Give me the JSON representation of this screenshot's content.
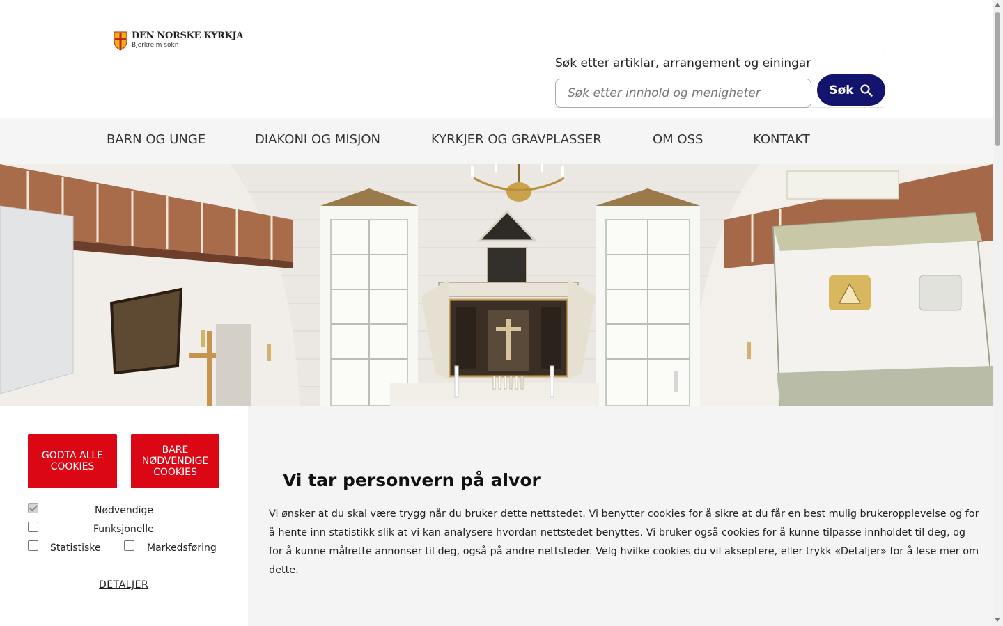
{
  "logo": {
    "title": "DEN NORSKE KYRKJA",
    "subtitle": "Bjerkreim sokn"
  },
  "search": {
    "label": "Søk etter artiklar, arrangement og einingar",
    "placeholder": "Søk etter innhold og menigheter",
    "button_label": "Søk",
    "button_color": "#13146c"
  },
  "nav": {
    "items": [
      {
        "label": "BARN OG UNGE"
      },
      {
        "label": "DIAKONI OG MISJON"
      },
      {
        "label": "KYRKJER OG GRAVPLASSER"
      },
      {
        "label": "OM OSS"
      },
      {
        "label": "KONTAKT"
      }
    ]
  },
  "cookies": {
    "accept_all_label": "GODTA ALLE COOKIES",
    "necessary_only_label": "BARE NØDVENDIGE COOKIES",
    "button_color": "#dc0715",
    "options": {
      "necessary": {
        "label": "Nødvendige",
        "checked": true,
        "disabled": true
      },
      "functional": {
        "label": "Funksjonelle",
        "checked": false
      },
      "statistics": {
        "label": "Statistiske",
        "checked": false
      },
      "marketing": {
        "label": "Markedsføring",
        "checked": false
      }
    },
    "details_label": "DETALJER",
    "title": "Vi tar personvern på alvor",
    "text": "Vi ønsker at du skal være trygg når du bruker dette nettstedet. Vi benytter cookies for å sikre at du får en best mulig brukeropplevelse og for å hente inn statistikk slik at vi kan analysere hvordan nettstedet benyttes. Vi bruker også cookies for å kunne tilpasse innholdet til deg, og for å kunne målrette annonser til deg, også på andre nettsteder. Velg hvilke cookies du vil akseptere, eller trykk «Detaljer» for å lese mer om dette."
  }
}
